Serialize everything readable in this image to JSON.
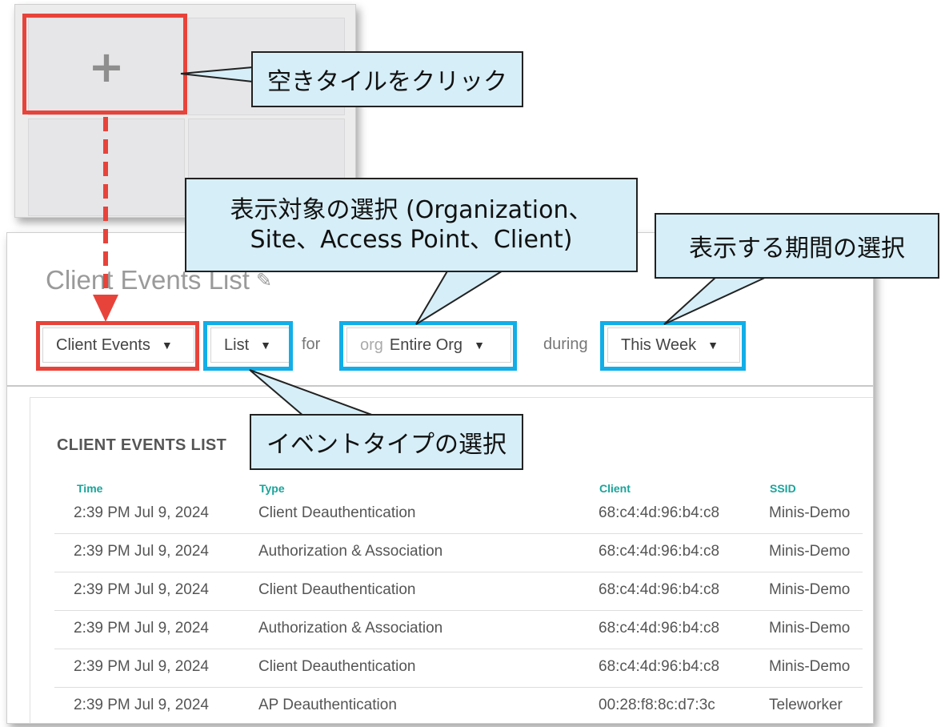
{
  "tile_panel": {
    "add_symbol": "+"
  },
  "callouts": {
    "click_empty_tile": "空きタイルをクリック",
    "select_target_line1": "表示対象の選択 (Organization、",
    "select_target_line2": "Site、Access Point、Client)",
    "select_period": "表示する期間の選択",
    "select_event_type": "イベントタイプの選択"
  },
  "widget": {
    "title": "Client Events List",
    "dropdowns": {
      "data_type": "Client Events",
      "view": "List",
      "for_label": "for",
      "scope_prefix": "org",
      "scope": "Entire Org",
      "during_label": "during",
      "period": "This Week"
    },
    "card": {
      "title": "CLIENT EVENTS LIST",
      "columns": [
        "Time",
        "Type",
        "Client",
        "SSID"
      ],
      "rows": [
        {
          "time": "2:39 PM Jul 9, 2024",
          "type": "Client Deauthentication",
          "client": "68:c4:4d:96:b4:c8",
          "ssid": "Minis-Demo"
        },
        {
          "time": "2:39 PM Jul 9, 2024",
          "type": "Authorization & Association",
          "client": "68:c4:4d:96:b4:c8",
          "ssid": "Minis-Demo"
        },
        {
          "time": "2:39 PM Jul 9, 2024",
          "type": "Client Deauthentication",
          "client": "68:c4:4d:96:b4:c8",
          "ssid": "Minis-Demo"
        },
        {
          "time": "2:39 PM Jul 9, 2024",
          "type": "Authorization & Association",
          "client": "68:c4:4d:96:b4:c8",
          "ssid": "Minis-Demo"
        },
        {
          "time": "2:39 PM Jul 9, 2024",
          "type": "Client Deauthentication",
          "client": "68:c4:4d:96:b4:c8",
          "ssid": "Minis-Demo"
        },
        {
          "time": "2:39 PM Jul 9, 2024",
          "type": "AP Deauthentication",
          "client": "00:28:f8:8c:d7:3c",
          "ssid": "Teleworker"
        }
      ]
    }
  },
  "colors": {
    "highlight_red": "#e8433a",
    "highlight_blue": "#11aee8",
    "callout_fill": "#d6eef7",
    "header_teal": "#1aa39a"
  }
}
